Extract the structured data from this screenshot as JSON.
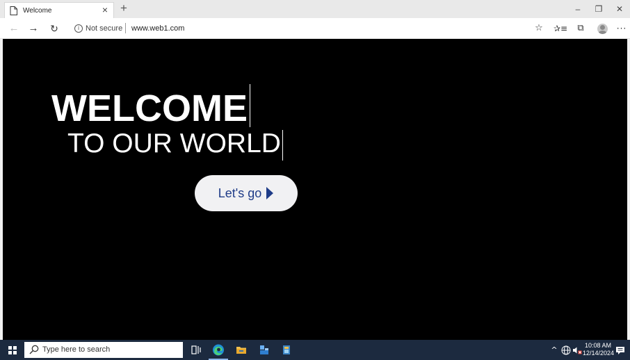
{
  "browser": {
    "tab": {
      "title": "Welcome",
      "close_glyph": "×",
      "icon": "page-icon"
    },
    "new_tab_glyph": "+",
    "window_controls": {
      "minimize": "–",
      "restore": "❐",
      "close": "✕"
    },
    "nav": {
      "back": "←",
      "forward": "→",
      "refresh": "↻"
    },
    "address": {
      "info_glyph": "i",
      "security_label": "Not secure",
      "url": "www.web1.com"
    },
    "toolbar": {
      "favorite_glyph": "☆",
      "favorites_glyph": "✰≡",
      "collections_glyph": "⧉",
      "more_glyph": "···"
    }
  },
  "page": {
    "title": "WELCOME",
    "subtitle": "TO OUR WORLD",
    "cta_label": "Let's go",
    "background_color": "#000000",
    "cta_text_color": "#1f3c88"
  },
  "taskbar": {
    "search_placeholder": "Type here to search",
    "tray_chevron": "^",
    "clock": {
      "time": "10:08 AM",
      "date": "12/14/2024"
    },
    "background_color": "#1c2a3f"
  }
}
